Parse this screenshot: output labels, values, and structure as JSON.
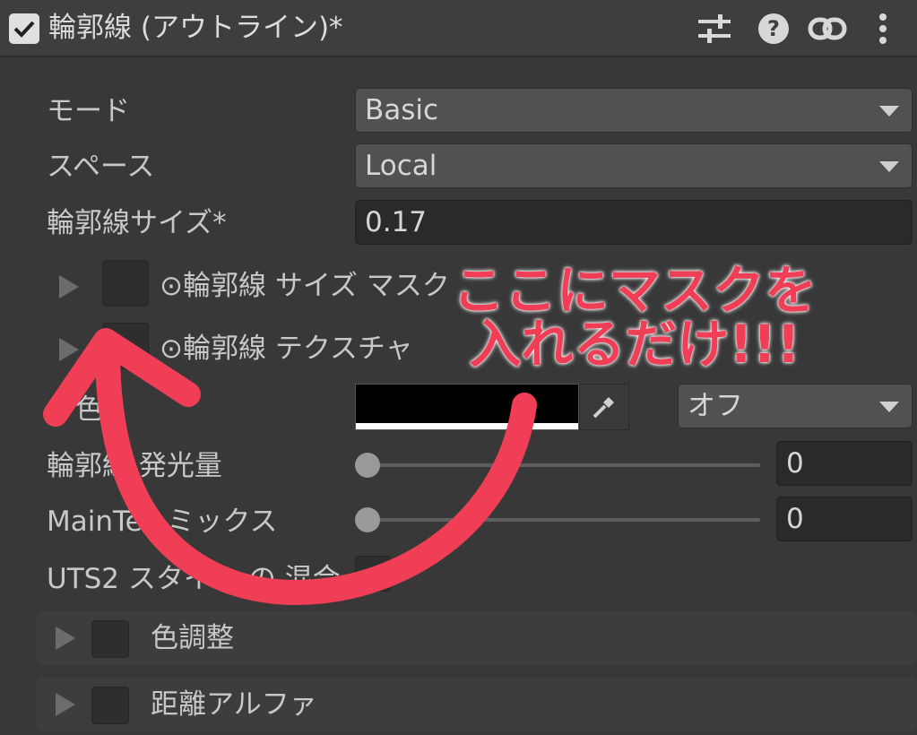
{
  "header": {
    "title": "輪郭線 (アウトライン)*",
    "checked": true,
    "icons": [
      "sliders-icon",
      "help-icon",
      "link-icon",
      "more-vert-icon"
    ]
  },
  "rows": {
    "mode": {
      "label": "モード",
      "value": "Basic"
    },
    "space": {
      "label": "スペース",
      "value": "Local"
    },
    "size": {
      "label": "輪郭線サイズ*",
      "value": "0.17"
    },
    "size_mask": {
      "label": "⊙輪郭線 サイズ マスク"
    },
    "texture": {
      "label": "⊙輪郭線 テクスチャ"
    },
    "color": {
      "label": "色",
      "swatch": "#000000",
      "mode": "オフ"
    },
    "emission": {
      "label": "輪郭線 発光量",
      "value": "0"
    },
    "maintex": {
      "label": "MainTex ミックス",
      "value": "0"
    },
    "uts2": {
      "label": "UTS2 スタイル の 混合"
    }
  },
  "sections": [
    {
      "label": "色調整"
    },
    {
      "label": "距離アルファ"
    }
  ],
  "annotation": {
    "line1": "ここにマスクを",
    "line2": "入れるだけ!!!"
  },
  "colors": {
    "annotation": "#ef3e56",
    "background": "#383838"
  }
}
